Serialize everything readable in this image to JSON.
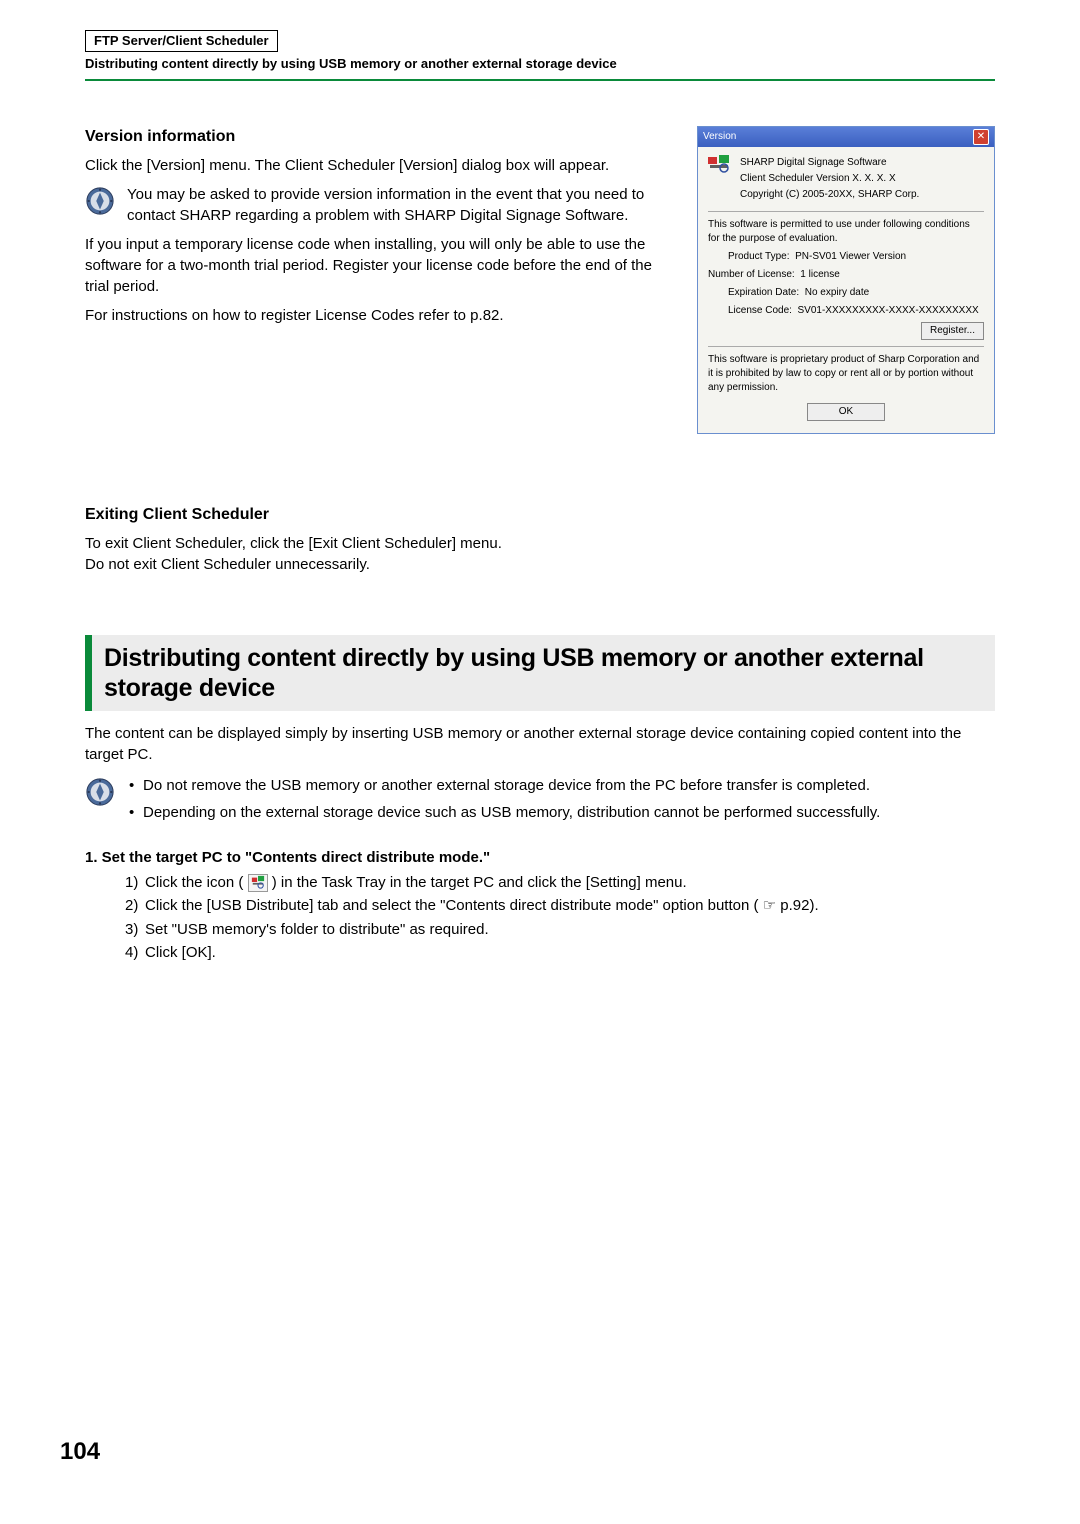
{
  "header": {
    "box": "FTP Server/Client Scheduler",
    "sub": "Distributing content directly by using USB memory or another external storage device"
  },
  "version_section": {
    "title": "Version information",
    "intro": "Click the [Version] menu. The Client Scheduler [Version] dialog box will appear.",
    "note": "You may be asked to provide version information in the event that you need to contact SHARP regarding a problem with SHARP Digital Signage Software.",
    "p2a": "If you input a temporary license code when installing, you will only be able to use the software for a two-month trial period. Register your license code before the end of the trial period.",
    "p2b": "For instructions on how to register License Codes refer to p.82."
  },
  "dialog": {
    "title": "Version",
    "line1": "SHARP Digital Signage Software",
    "line2": "Client Scheduler  Version X. X. X. X",
    "line3": "Copyright (C) 2005-20XX, SHARP Corp.",
    "cond": "This software is permitted to use under following conditions for the purpose of evaluation.",
    "ptype_label": "Product Type:",
    "ptype_value": "PN-SV01  Viewer Version",
    "nlic_label": "Number of License:",
    "nlic_value": "1 license",
    "exp_label": "Expiration Date:",
    "exp_value": "No expiry date",
    "lic_label": "License Code:",
    "lic_value": "SV01-XXXXXXXXX-XXXX-XXXXXXXXX",
    "register": "Register...",
    "legal": "This software is proprietary product of Sharp Corporation and it is prohibited by law to copy or rent all or by portion without any permission.",
    "ok": "OK"
  },
  "exit_section": {
    "title": "Exiting Client Scheduler",
    "p1": "To exit Client Scheduler, click the [Exit Client Scheduler] menu.",
    "p2": "Do not exit Client Scheduler unnecessarily."
  },
  "big_heading": "Distributing content directly by using USB memory or another external storage device",
  "dist_intro": "The content can be displayed simply by inserting USB memory or another external storage device containing copied content into the target PC.",
  "dist_bullets": [
    "Do not remove the USB memory or another external storage device from the PC before transfer is completed.",
    "Depending on the external storage device such as USB memory, distribution cannot be performed successfully."
  ],
  "step_heading": "1.  Set the target PC to \"Contents direct distribute mode.\"",
  "steps": {
    "s1a": "Click the icon (",
    "s1b": ") in the Task Tray in the target PC and click the [Setting] menu.",
    "s2a": "Click the [USB Distribute] tab and select the \"Contents direct distribute mode\" option button (",
    "s2b": "p.92).",
    "s3": "Set \"USB memory's folder to distribute\" as required.",
    "s4": "Click [OK]."
  },
  "icons": {
    "tray_icon": "tray-icon",
    "hand": "☞"
  },
  "page_number": "104"
}
